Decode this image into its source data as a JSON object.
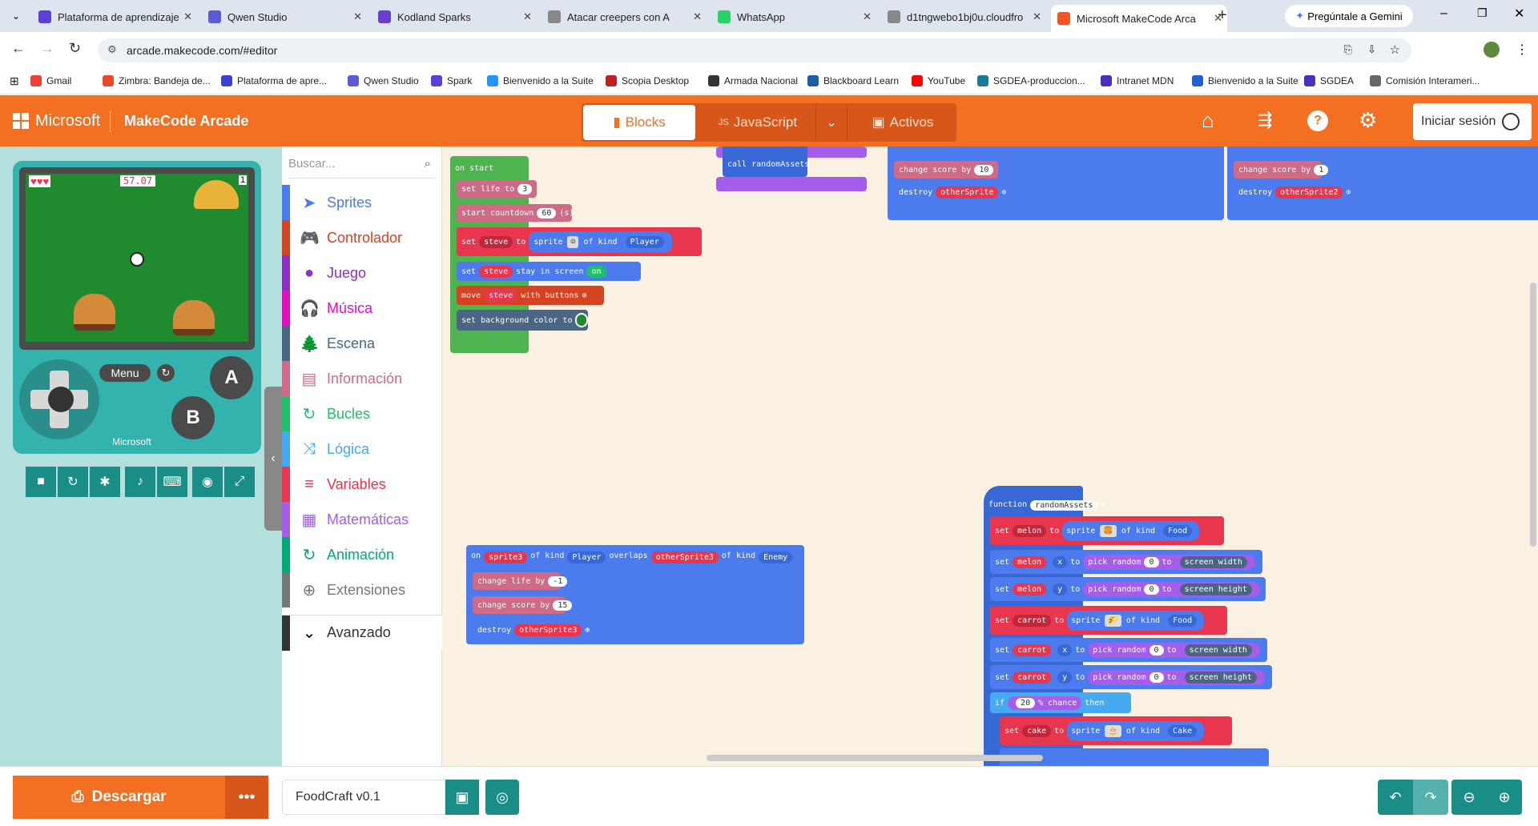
{
  "browser": {
    "tabs": [
      {
        "label": "Plataforma de aprendizaje",
        "icon": "k-icon",
        "color": "#5a3fd8"
      },
      {
        "label": "Qwen Studio",
        "icon": "qwen-icon",
        "color": "#5b5bd6"
      },
      {
        "label": "Kodland Sparks",
        "icon": "k-icon",
        "color": "#6a3fd0"
      },
      {
        "label": "Atacar creepers con A",
        "icon": "globe-icon",
        "color": "#888888"
      },
      {
        "label": "WhatsApp",
        "icon": "whatsapp-icon",
        "color": "#25d366"
      },
      {
        "label": "d1tngwebo1bj0u.cloudfro",
        "icon": "globe-icon",
        "color": "#888888"
      },
      {
        "label": "Microsoft MakeCode Arca",
        "icon": "ms-icon",
        "color": "#f35325"
      }
    ],
    "gemini": "Pregúntale a Gemini",
    "url": "arcade.makecode.com/#editor",
    "bookmarks": [
      "Gmail",
      "Zimbra: Bandeja de...",
      "Plataforma de apre...",
      "Qwen Studio",
      "Spark",
      "Bienvenido a la Suite",
      "Scopia Desktop",
      "Armada Nacional",
      "Blackboard Learn",
      "YouTube",
      "SGDEA-produccion...",
      "Intranet MDN",
      "Bienvenido a la Suite",
      "SGDEA",
      "Comisión Interameri..."
    ]
  },
  "header": {
    "brand": "Microsoft",
    "product": "MakeCode Arcade",
    "tabs": [
      "Blocks",
      "JavaScript",
      "Activos"
    ],
    "login": "Iniciar sesión"
  },
  "simulator": {
    "menu": "Menu",
    "score": "57.07",
    "life": "1",
    "a": "A",
    "b": "B",
    "brand": "Microsoft"
  },
  "toolbox": {
    "search_placeholder": "Buscar...",
    "categories": [
      {
        "label": "Sprites",
        "color": "#4b7bec",
        "icon": "➤"
      },
      {
        "label": "Controlador",
        "color": "#d54322",
        "icon": "🎮"
      },
      {
        "label": "Juego",
        "color": "#8e2ec4",
        "icon": "●"
      },
      {
        "label": "Música",
        "color": "#e30fc0",
        "icon": "🎧"
      },
      {
        "label": "Escena",
        "color": "#4b6584",
        "icon": "🌲"
      },
      {
        "label": "Información",
        "color": "#cf6a87",
        "icon": "▤"
      },
      {
        "label": "Bucles",
        "color": "#20bf6b",
        "icon": "↻"
      },
      {
        "label": "Lógica",
        "color": "#45aaf2",
        "icon": "⤨"
      },
      {
        "label": "Variables",
        "color": "#e8364e",
        "icon": "≡"
      },
      {
        "label": "Matemáticas",
        "color": "#a55eea",
        "icon": "▦"
      },
      {
        "label": "Animación",
        "color": "#03aa74",
        "icon": "↻"
      },
      {
        "label": "Extensiones",
        "color": "#777777",
        "icon": "⊕"
      }
    ],
    "advanced": "Avanzado"
  },
  "blocks": {
    "on_start": "on start",
    "set_life": "set life to",
    "life_val": "3",
    "countdown": "start countdown",
    "countdown_val": "60",
    "countdown_unit": "(s)",
    "set": "set",
    "steve": "steve",
    "to": "to",
    "sprite": "sprite",
    "of_kind": "of kind",
    "player": "Player",
    "stay": "stay in screen",
    "on": "on",
    "move": "move",
    "with_buttons": "with buttons",
    "bg": "set background color to",
    "call": "call randomAssets",
    "change_score": "change score by",
    "score10": "10",
    "score1": "1",
    "destroy": "destroy",
    "other": "otherSprite",
    "other2": "otherSprite2",
    "sprite3": "sprite3",
    "enemy": "Enemy",
    "overlaps": "overlaps",
    "other3": "otherSprite3",
    "change_life": "change life by",
    "life_neg": "-1",
    "score15": "15",
    "function": "function",
    "fname": "randomAssets",
    "melon": "melon",
    "carrot": "carrot",
    "cake": "cake",
    "food": "Food",
    "cake_kind": "Cake",
    "x": "x",
    "y": "y",
    "pick": "pick random",
    "zero": "0",
    "sw": "screen width",
    "sh": "screen height",
    "if": "if",
    "chance": "% chance",
    "chance_val": "20",
    "then": "then"
  },
  "footer": {
    "download": "Descargar",
    "project": "FoodCraft v0.1"
  }
}
